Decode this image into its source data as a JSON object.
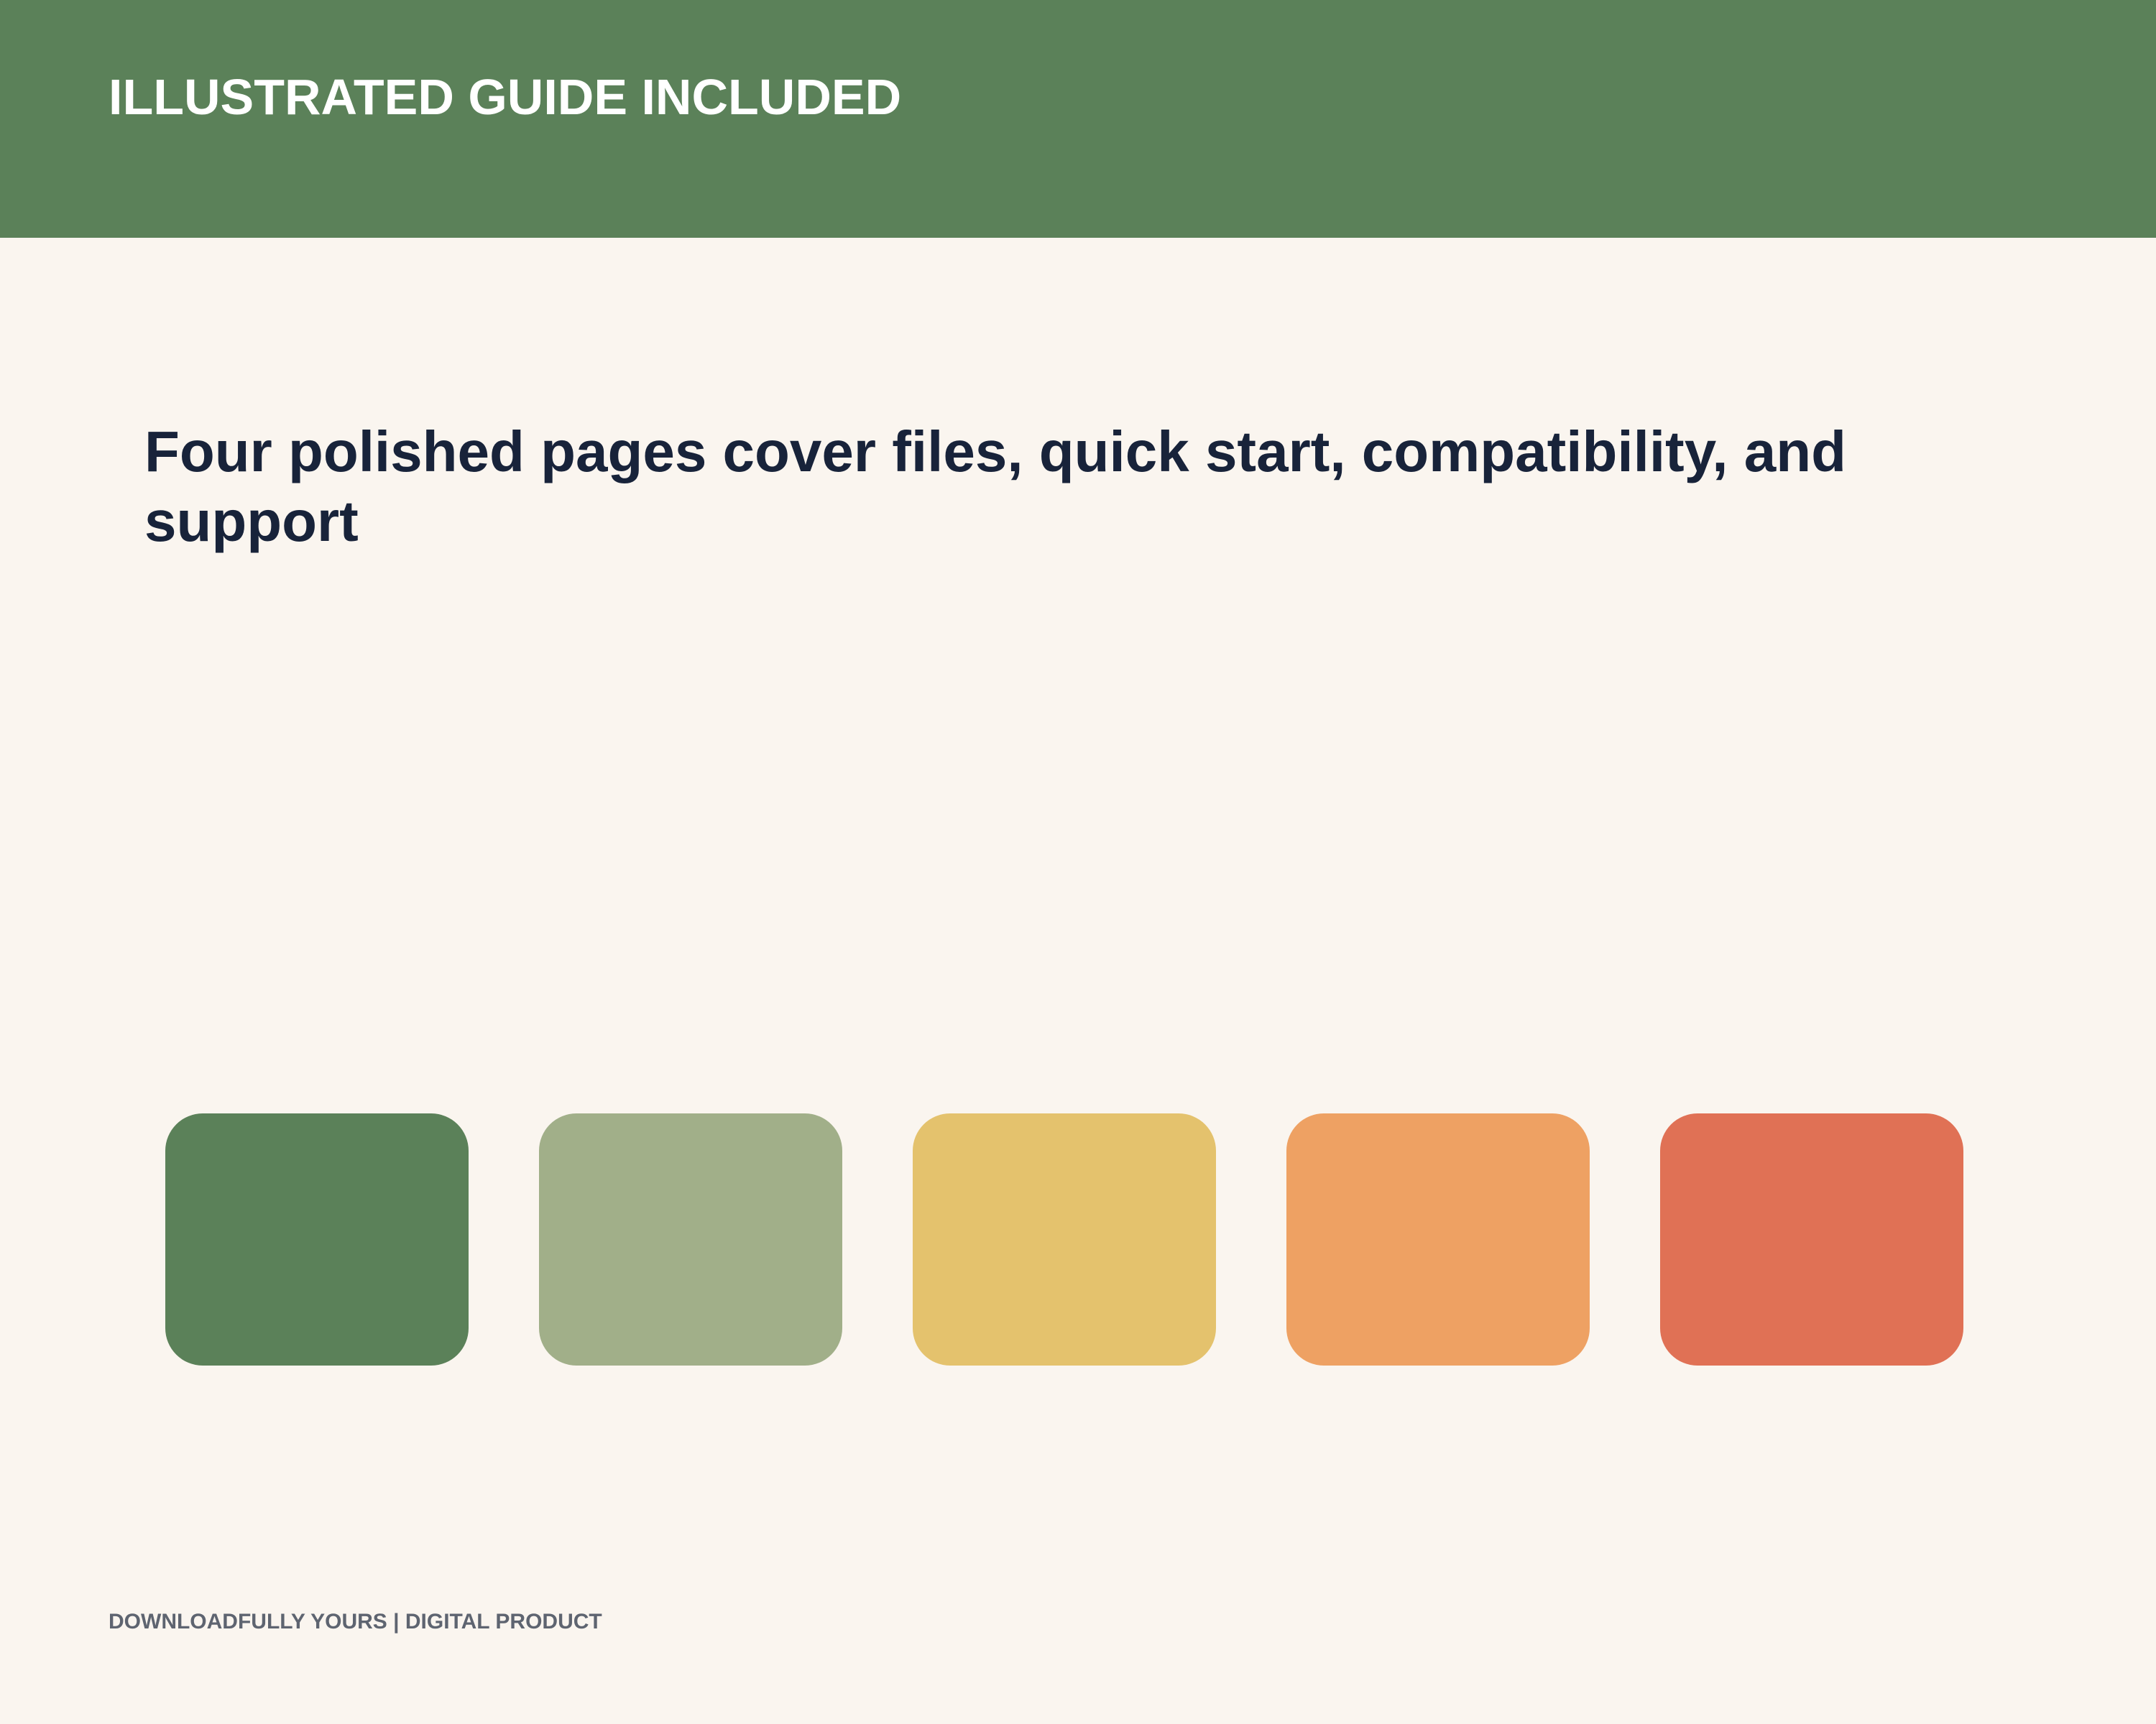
{
  "header": {
    "title": "ILLUSTRATED GUIDE INCLUDED",
    "background_color": "#5B8159"
  },
  "main": {
    "headline": "Four polished pages cover files, quick start, compatibility, and support"
  },
  "palette": {
    "swatches": [
      {
        "name": "forest-green",
        "color": "#5B8159"
      },
      {
        "name": "sage-green",
        "color": "#A1AF89"
      },
      {
        "name": "mustard-yellow",
        "color": "#E4C26D"
      },
      {
        "name": "apricot-orange",
        "color": "#EEA163"
      },
      {
        "name": "coral-red",
        "color": "#E07155"
      }
    ]
  },
  "footer": {
    "text": "DOWNLOADFULLY YOURS | DIGITAL PRODUCT"
  },
  "colors": {
    "page_background": "#FAF5EF",
    "headline_text": "#18233A",
    "footer_text": "#5E6470"
  }
}
